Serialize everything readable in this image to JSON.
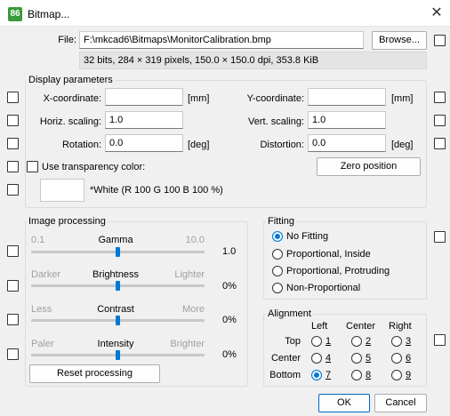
{
  "window": {
    "title": "Bitmap...",
    "app_icon": "86",
    "close_icon": "close-icon"
  },
  "file": {
    "label": "File:",
    "path": "F:\\mkcad6\\Bitmaps\\MonitorCalibration.bmp",
    "browse": "Browse...",
    "info": "32 bits, 284 × 319 pixels, 150.0 × 150.0 dpi, 353.8 KiB"
  },
  "display": {
    "title": "Display parameters",
    "x_label": "X-coordinate:",
    "x_value": "",
    "x_unit": "[mm]",
    "y_label": "Y-coordinate:",
    "y_value": "",
    "y_unit": "[mm]",
    "hscale_label": "Horiz. scaling:",
    "hscale_value": "1.0",
    "vscale_label": "Vert. scaling:",
    "vscale_value": "1.0",
    "rotation_label": "Rotation:",
    "rotation_value": "0.0",
    "rotation_unit": "[deg]",
    "distortion_label": "Distortion:",
    "distortion_value": "0.0",
    "distortion_unit": "[deg]",
    "transparency_label": "Use transparency color:",
    "zero_position": "Zero position",
    "color_text": "*White (R 100 G 100 B 100 %)",
    "swatch_color": "#ffffff"
  },
  "processing": {
    "title": "Image processing",
    "reset": "Reset processing",
    "sliders": [
      {
        "left": "0.1",
        "name": "Gamma",
        "right": "10.0",
        "value": "1.0",
        "position": 0.5
      },
      {
        "left": "Darker",
        "name": "Brightness",
        "right": "Lighter",
        "value": "0%",
        "position": 0.5
      },
      {
        "left": "Less",
        "name": "Contrast",
        "right": "More",
        "value": "0%",
        "position": 0.5
      },
      {
        "left": "Paler",
        "name": "Intensity",
        "right": "Brighter",
        "value": "0%",
        "position": 0.5
      }
    ]
  },
  "fitting": {
    "title": "Fitting",
    "options": [
      "No Fitting",
      "Proportional, Inside",
      "Proportional, Protruding",
      "Non-Proportional"
    ],
    "selected": 0
  },
  "alignment": {
    "title": "Alignment",
    "columns": [
      "Left",
      "Center",
      "Right"
    ],
    "rows": [
      "Top",
      "Center",
      "Bottom"
    ],
    "numbers": [
      "1",
      "2",
      "3",
      "4",
      "5",
      "6",
      "7",
      "8",
      "9"
    ],
    "selected": "7"
  },
  "footer": {
    "ok": "OK",
    "cancel": "Cancel"
  },
  "colors": {
    "accent": "#0078d4",
    "app_icon_bg": "#3a9a3c",
    "disabled_text": "#a0a0a0"
  }
}
